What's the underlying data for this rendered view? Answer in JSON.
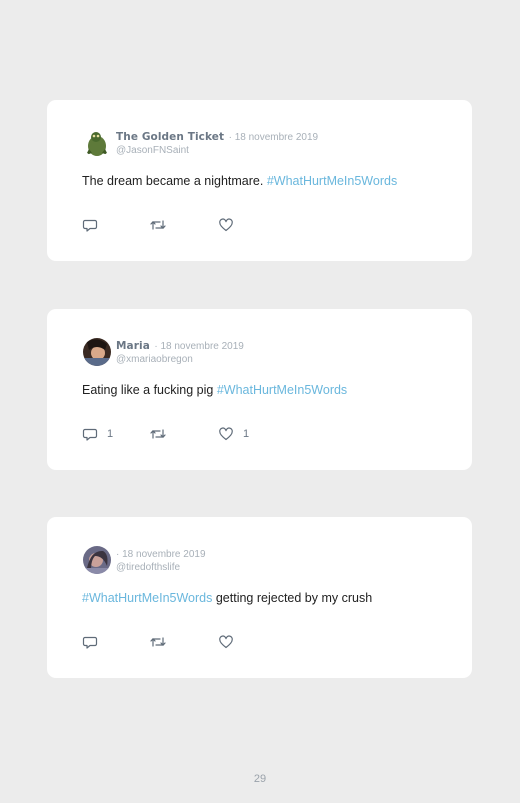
{
  "tweets": [
    {
      "name": "The Golden Ticket",
      "date": "· 18 novembre 2019",
      "handle": "@JasonFNSaint",
      "text": "The dream became a nightmare. ",
      "hashtag": "#WhatHurtMeIn5Words",
      "trailing": "",
      "replies": "",
      "likes": ""
    },
    {
      "name": "Maria",
      "date": "· 18 novembre 2019",
      "handle": "@xmariaobregon",
      "text": "Eating like a fucking pig ",
      "hashtag": "#WhatHurtMeIn5Words",
      "trailing": "",
      "replies": "1",
      "likes": "1"
    },
    {
      "name": "",
      "date": "· 18 novembre 2019",
      "handle": "@tiredofthslife",
      "text": "",
      "hashtag": "#WhatHurtMeIn5Words",
      "trailing": " getting rejected by my crush",
      "replies": "",
      "likes": ""
    }
  ],
  "icons": [
    "reply-icon",
    "retweet-icon",
    "like-icon"
  ],
  "colors": {
    "hashtag": "#6ab7dd",
    "name": "#6b7785",
    "meta": "#a8b0b8",
    "background": "#ececec"
  },
  "page_number": "29"
}
